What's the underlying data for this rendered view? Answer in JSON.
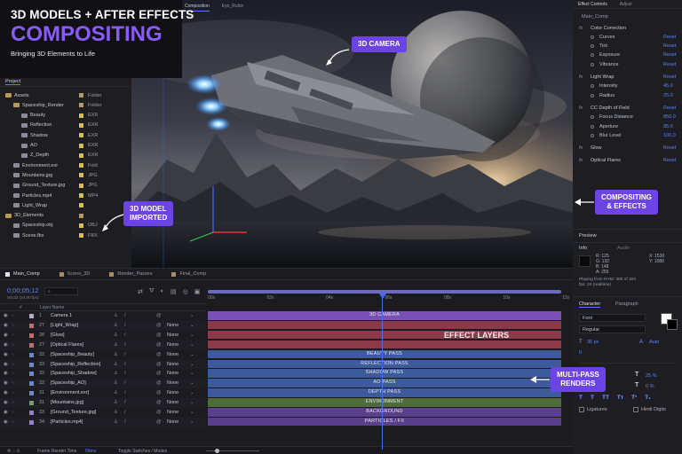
{
  "overlay": {
    "title_top": "3D MODELS + AFTER EFFECTS",
    "title_main": "COMPOSITING",
    "subtitle": "Bringing 3D Elements to Life"
  },
  "callouts": {
    "camera": "3D CAMERA",
    "model": [
      "3D MODEL",
      "IMPORTED"
    ],
    "compositing": [
      "COMPOSITING",
      "& EFFECTS"
    ],
    "multipass": [
      "MULTI-PASS",
      "RENDERS"
    ],
    "effect_layers": "EFFECT LAYERS"
  },
  "viewer": {
    "tabs": [
      "Composition",
      "Eye_Rubin"
    ]
  },
  "project": {
    "tab": "Project",
    "items": [
      {
        "name": "Assets",
        "type": "Folder",
        "indent": 0,
        "kind": "folder"
      },
      {
        "name": "Spaceship_Render",
        "type": "Folder",
        "indent": 1,
        "kind": "folder"
      },
      {
        "name": "Beauty",
        "type": "EXR",
        "indent": 2,
        "kind": "file"
      },
      {
        "name": "Reflection",
        "type": "EXR",
        "indent": 2,
        "kind": "file"
      },
      {
        "name": "Shadow",
        "type": "EXR",
        "indent": 2,
        "kind": "file"
      },
      {
        "name": "AO",
        "type": "EXR",
        "indent": 2,
        "kind": "file"
      },
      {
        "name": "Z_Depth",
        "type": "EXR",
        "indent": 2,
        "kind": "file"
      },
      {
        "name": "Environment.exr",
        "type": "Fold",
        "indent": 1,
        "kind": "file"
      },
      {
        "name": "Mountains.jpg",
        "type": "JPG",
        "indent": 1,
        "kind": "file"
      },
      {
        "name": "Ground_Texture.jpg",
        "type": "JPG",
        "indent": 1,
        "kind": "file"
      },
      {
        "name": "Particles.mp4",
        "type": "MP4",
        "indent": 1,
        "kind": "file"
      },
      {
        "name": "Light_Wrap",
        "type": "",
        "indent": 1,
        "kind": "file"
      },
      {
        "name": "3D_Elements",
        "type": "",
        "indent": 0,
        "kind": "folder"
      },
      {
        "name": "Spaceship.obj",
        "type": "OBJ",
        "indent": 1,
        "kind": "file"
      },
      {
        "name": "Scene.fbx",
        "type": "FBX",
        "indent": 1,
        "kind": "file"
      }
    ]
  },
  "effects": {
    "tabs": [
      "Effect Controls",
      "Adjust"
    ],
    "comp": "Main_Comp",
    "rows": [
      {
        "kind": "fx",
        "name": "Color Correction",
        "value": ""
      },
      {
        "kind": "prop",
        "name": "Curves",
        "value": "Reset"
      },
      {
        "kind": "prop",
        "name": "Tint",
        "value": "Reset"
      },
      {
        "kind": "prop",
        "name": "Exposure",
        "value": "Reset"
      },
      {
        "kind": "prop",
        "name": "Vibrance",
        "value": "Reset"
      },
      {
        "kind": "fx",
        "name": "Light Wrap",
        "value": "Reset"
      },
      {
        "kind": "prop",
        "name": "Intensity",
        "value": "45.0"
      },
      {
        "kind": "prop",
        "name": "Radius",
        "value": "25.0"
      },
      {
        "kind": "fx",
        "name": "CC Depth of Field",
        "value": "Reset"
      },
      {
        "kind": "prop",
        "name": "Focus Distance",
        "value": "850.0"
      },
      {
        "kind": "prop",
        "name": "Aperture",
        "value": "85.0"
      },
      {
        "kind": "prop",
        "name": "Blur Level",
        "value": "100.0"
      },
      {
        "kind": "fx",
        "name": "Glow",
        "value": "Reset"
      },
      {
        "kind": "fx",
        "name": "Optical Flares",
        "value": "Reset"
      }
    ]
  },
  "preview": {
    "title": "Preview",
    "info_tab": "Info",
    "audio_tab": "Audio",
    "rgba": [
      "R: 125",
      "G: 132",
      "B: 148",
      "A: 255"
    ],
    "coords": [
      "X: 1530",
      "Y: 1080"
    ],
    "status": "Playing from RAM: 300 of 300",
    "status2": "fps: 24 (realtime)"
  },
  "character": {
    "tabs": [
      "Character",
      "Paragraph"
    ],
    "font": "Font",
    "style": "Regular",
    "size": "36 px",
    "leading": "Auto",
    "tracking": "0",
    "scale_v": "25 %",
    "scale_h": "0 %",
    "ligatures": "Ligatures",
    "hindi": "Hindi Digits"
  },
  "timeline": {
    "tabs": [
      "Main_Comp",
      "Scene_3D",
      "Render_Passes",
      "Final_Comp"
    ],
    "timecode": "0;00;05;12",
    "fps_note": "00132 (24.00 fps)",
    "header": [
      "#",
      "Layer Name"
    ],
    "ruler": [
      "00s",
      "02s",
      "04s",
      "06s",
      "08s",
      "10s",
      "12s"
    ],
    "footer_time_label": "Frame Render Time",
    "footer_time": "56ms",
    "footer_toggle": "Toggle Switches / Modes",
    "layers": [
      {
        "num": "1",
        "name": "Camera 1",
        "mode": "",
        "color": "#b8a7d8"
      },
      {
        "num": "27",
        "name": "[Light_Wrap]",
        "mode": "None",
        "color": "#c86a6a"
      },
      {
        "num": "28",
        "name": "[Glow]",
        "mode": "None",
        "color": "#c86a6a"
      },
      {
        "num": "27",
        "name": "[Optical Flares]",
        "mode": "None",
        "color": "#c86a6a"
      },
      {
        "num": "32",
        "name": "[Spaceship_Beauty]",
        "mode": "None",
        "color": "#6b86d8"
      },
      {
        "num": "33",
        "name": "[Spaceship_Reflection]",
        "mode": "None",
        "color": "#6b86d8"
      },
      {
        "num": "32",
        "name": "[Spaceship_Shadow]",
        "mode": "None",
        "color": "#6b86d8"
      },
      {
        "num": "32",
        "name": "[Spaceship_AO]",
        "mode": "None",
        "color": "#6b86d8"
      },
      {
        "num": "31",
        "name": "[Environment.exr]",
        "mode": "None",
        "color": "#6b86d8"
      },
      {
        "num": "31",
        "name": "[Mountains.jpg]",
        "mode": "None",
        "color": "#6ea36b"
      },
      {
        "num": "33",
        "name": "[Ground_Texture.jpg]",
        "mode": "None",
        "color": "#9a7bd8"
      },
      {
        "num": "34",
        "name": "[Particles.mp4]",
        "mode": "None",
        "color": "#9a7bd8"
      }
    ],
    "tracks": [
      {
        "label": "3D CAMERA",
        "color": "#7a4fb8"
      },
      {
        "label": "",
        "color": "#8c3a4a"
      },
      {
        "label": "",
        "color": "#8c3a4a"
      },
      {
        "label": "",
        "color": "#8c3a4a"
      },
      {
        "label": "BEAUTY PASS",
        "color": "#3d5a9c"
      },
      {
        "label": "REFLECTION PASS",
        "color": "#3d5a9c"
      },
      {
        "label": "SHADOW PASS",
        "color": "#3d5a9c"
      },
      {
        "label": "AO PASS",
        "color": "#3d5a9c"
      },
      {
        "label": "DEPTH PASS",
        "color": "#3d5a9c"
      },
      {
        "label": "ENVIRONMENT",
        "color": "#4f6b3a"
      },
      {
        "label": "BACKGROUND",
        "color": "#5a3f8c"
      },
      {
        "label": "PARTICLES / FX",
        "color": "#5a3f8c"
      }
    ]
  }
}
